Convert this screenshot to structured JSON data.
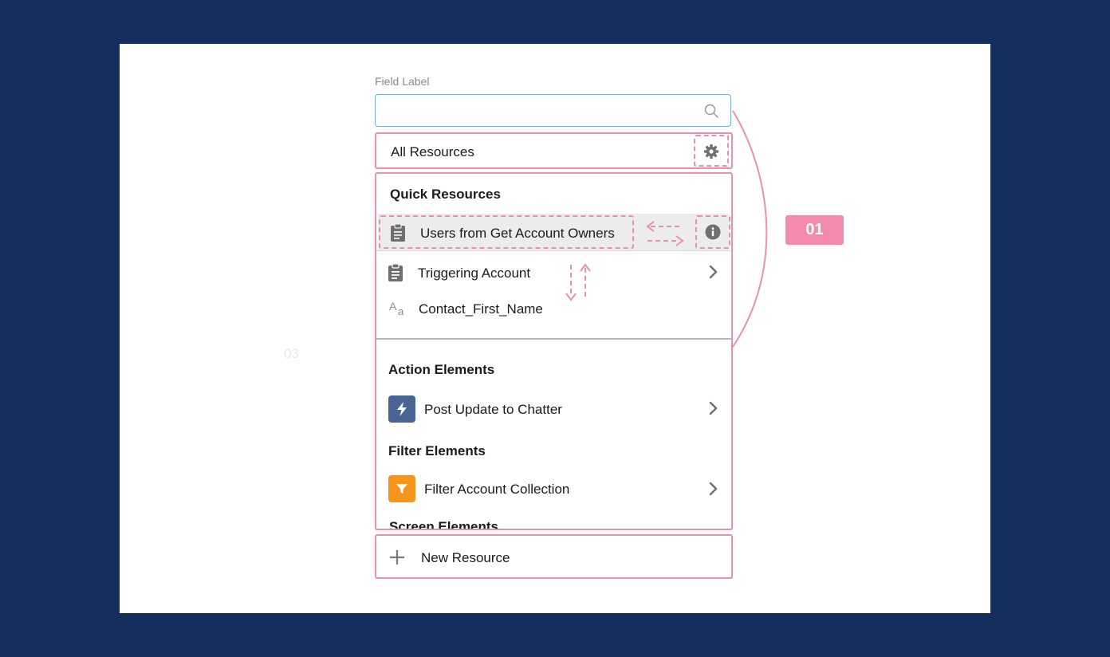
{
  "field": {
    "label": "Field Label",
    "value": "",
    "placeholder": ""
  },
  "filter": {
    "label": "All Resources",
    "settings_icon": "gear-icon"
  },
  "quick_resources": {
    "title": "Quick Resources",
    "items": [
      {
        "label": "Users from Get Account Owners",
        "icon": "clipboard-icon",
        "trailing": "info-icon",
        "highlighted": true
      },
      {
        "label": "Triggering Account",
        "icon": "clipboard-icon",
        "trailing": "chevron-right-icon"
      },
      {
        "label": "Contact_First_Name",
        "icon": "text-type-icon"
      }
    ]
  },
  "action_elements": {
    "title": "Action Elements",
    "items": [
      {
        "label": "Post Update to Chatter",
        "icon": "lightning-icon",
        "color": "#4a6595",
        "trailing": "chevron-right-icon"
      }
    ]
  },
  "filter_elements": {
    "title": "Filter Elements",
    "items": [
      {
        "label": "Filter Account Collection",
        "icon": "funnel-icon",
        "color": "#f7941d",
        "trailing": "chevron-right-icon"
      }
    ]
  },
  "screen_elements": {
    "title": "Screen Elements"
  },
  "footer": {
    "new_resource_label": "New Resource",
    "icon": "plus-icon"
  },
  "annotations": {
    "step_badge": "01",
    "ghost_label": "03",
    "accent_color": "#e98fb0",
    "badge_color": "#f48aab"
  }
}
